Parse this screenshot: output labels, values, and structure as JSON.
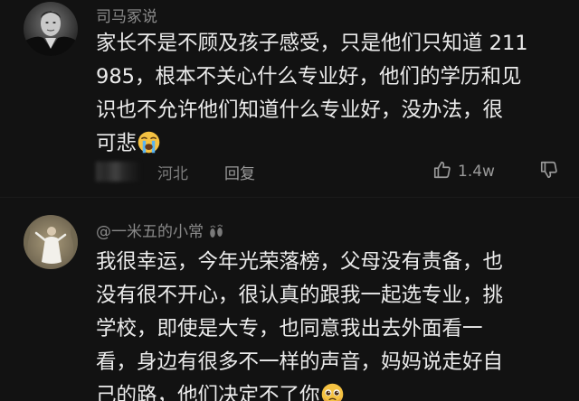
{
  "comments": [
    {
      "username": "司马冢说",
      "lines": [
        "家长不是不顾及孩子感受，只是他们只知道 211",
        "985，根本不关心什么专业好，他们的学历和见",
        "识也不允许他们知道什么专业好，没办法，很",
        "可悲"
      ],
      "emoji_icon": "loudly-crying-face",
      "location": "河北",
      "reply_label": "回复",
      "like_count": "1.4w"
    },
    {
      "username": "@一米五的小常",
      "username_icon": "footprints",
      "lines": [
        "我很幸运，今年光荣落榜，父母没有责备，也",
        "没有很不开心，很认真的跟我一起选专业，挑",
        "学校，即使是大专，也同意我出去外面看一",
        "看，身边有很多不一样的声音，妈妈说走好自",
        "己的路，他们决定不了你"
      ],
      "emoji_icon": "pleading-face"
    }
  ],
  "colors": {
    "background": "#121212",
    "text": "#ebebeb",
    "meta": "#8a8a8a"
  }
}
